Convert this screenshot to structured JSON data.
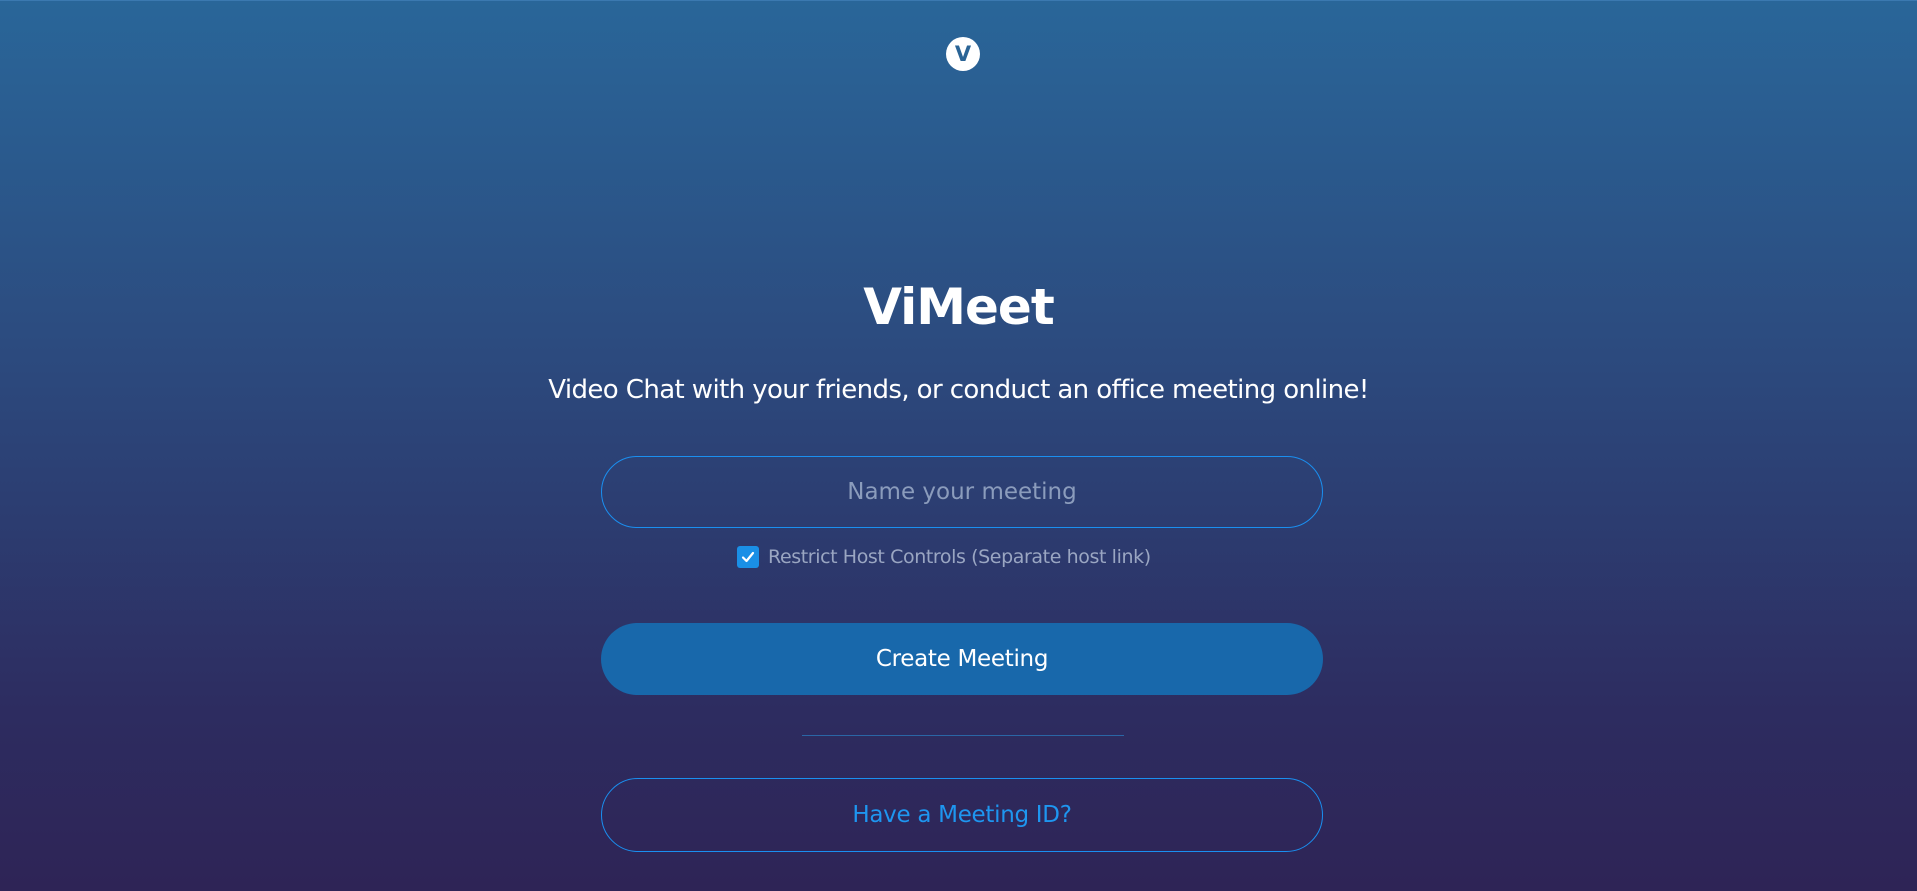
{
  "app": {
    "logo_letter": "V",
    "title": "ViMeet",
    "tagline": "Video Chat with your friends, or conduct an office meeting online!"
  },
  "form": {
    "meeting_name": {
      "value": "",
      "placeholder": "Name your meeting"
    },
    "restrict_host": {
      "checked": true,
      "label": "Restrict Host Controls (Separate host link)"
    },
    "create_label": "Create Meeting",
    "join_label": "Have a Meeting ID?"
  },
  "icons": {
    "logo": "vimeet-logo-icon",
    "checkbox": "checkmark-icon"
  },
  "colors": {
    "accent": "#1a8ff0",
    "primary_button": "#1868ab",
    "background_top": "#296699",
    "background_bottom": "#2e2456",
    "placeholder_text": "#8b9cbc",
    "link_text": "#1e96f0"
  }
}
